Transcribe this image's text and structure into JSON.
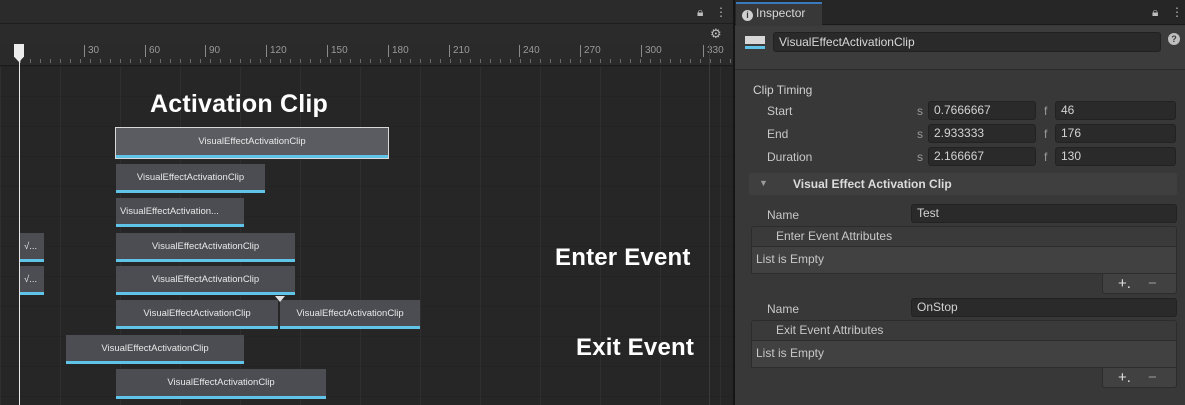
{
  "timeline": {
    "ruler_ticks": [
      "30",
      "60",
      "90",
      "120",
      "150",
      "180",
      "210",
      "240",
      "270",
      "300",
      "330"
    ],
    "clips": [
      {
        "label": "VisualEffectActivationClip"
      },
      {
        "label": "VisualEffectActivationClip"
      },
      {
        "label": "VisualEffectActivation..."
      },
      {
        "label": "√..."
      },
      {
        "label": "VisualEffectActivationClip"
      },
      {
        "label": "√..."
      },
      {
        "label": "VisualEffectActivationClip"
      },
      {
        "label": "VisualEffectActivationClip"
      },
      {
        "label": "VisualEffectActivationClip"
      },
      {
        "label": "VisualEffectActivationClip"
      },
      {
        "label": "VisualEffectActivationClip"
      }
    ]
  },
  "callouts": {
    "activation": "Activation Clip",
    "enter": "Enter Event",
    "exit": "Exit Event"
  },
  "inspector": {
    "tab_label": "Inspector",
    "object_name": "VisualEffectActivationClip",
    "clip_timing": {
      "title": "Clip Timing",
      "rows": [
        {
          "label": "Start",
          "s_unit": "s",
          "s_value": "0.7666667",
          "f_unit": "f",
          "f_value": "46"
        },
        {
          "label": "End",
          "s_unit": "s",
          "s_value": "2.933333",
          "f_unit": "f",
          "f_value": "176"
        },
        {
          "label": "Duration",
          "s_unit": "s",
          "s_value": "2.166667",
          "f_unit": "f",
          "f_value": "130"
        }
      ]
    },
    "activation_section": {
      "title": "Visual Effect Activation Clip",
      "enter": {
        "name_label": "Name",
        "name_value": "Test",
        "list_header": "Enter Event Attributes",
        "list_empty": "List is Empty"
      },
      "exit": {
        "name_label": "Name",
        "name_value": "OnStop",
        "list_header": "Exit Event Attributes",
        "list_empty": "List is Empty"
      }
    },
    "icons": {
      "add": "+.",
      "remove": "−"
    }
  }
}
